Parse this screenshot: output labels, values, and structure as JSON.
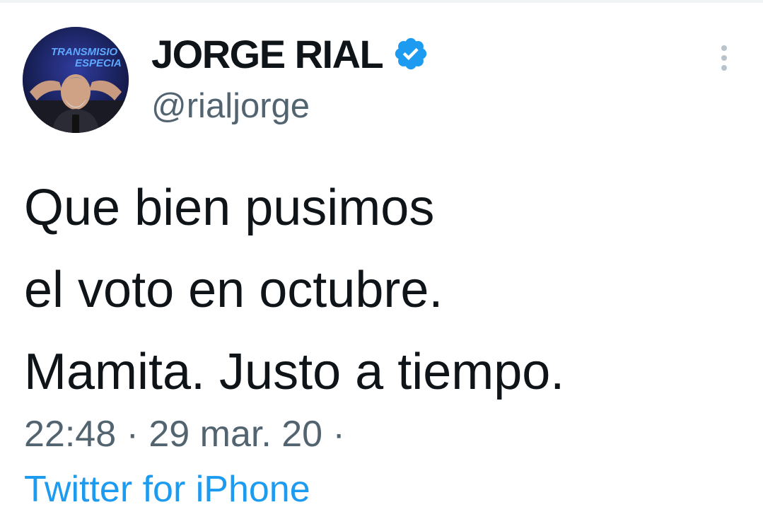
{
  "tweet": {
    "author": {
      "display_name": "JORGE RIAL",
      "handle": "@rialjorge",
      "verified": true,
      "avatar_banner_line1": "TRANSMISIO",
      "avatar_banner_line2": "ESPECIA"
    },
    "text_lines": [
      "Que bien pusimos",
      "el voto en octubre.",
      "Mamita. Justo a tiempo."
    ],
    "time": "22:48",
    "separator": "·",
    "date": "29 mar. 20",
    "trailing_separator": "·",
    "source": "Twitter for iPhone"
  },
  "icons": {
    "verified": "verified-badge-icon",
    "more": "more-options-icon"
  },
  "colors": {
    "verified_blue": "#1d9bf0",
    "link_blue": "#1d9bf0",
    "text_primary": "#0f1419",
    "text_secondary": "#536471",
    "more_icon": "#b9c3cb"
  }
}
